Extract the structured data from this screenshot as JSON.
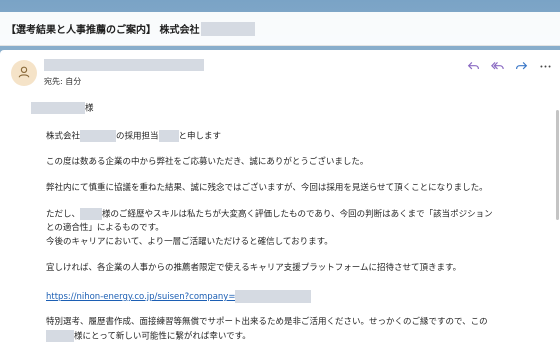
{
  "subject": {
    "title": "【選考結果と人事推薦のご案内】 株式会社"
  },
  "header": {
    "to_label": "宛先: 自分",
    "actions": [
      {
        "name": "reply-icon"
      },
      {
        "name": "reply-all-icon"
      },
      {
        "name": "forward-icon"
      },
      {
        "name": "more-icon"
      }
    ]
  },
  "message": {
    "salutation_suffix": "様",
    "line_intro_a": "株式会社",
    "line_intro_b": "の採用担当",
    "line_intro_c": "と申します",
    "line_thanks": "この度は数ある企業の中から弊社をご応募いただき、誠にありがとうございました。",
    "line_result": "弊社内にて慎重に協議を重ねた結果、誠に残念ではございますが、今回は採用を見送らせて頂くことになりました。",
    "line_however_a": "ただし、",
    "line_however_b": "様のご経歴やスキルは私たちが大変高く評価したものであり、今回の判断はあくまで「該当ポジション",
    "line_however_c": "との適合性」によるものです。",
    "line_future": "今後のキャリアにおいて、より一層ご活躍いただけると確信しております。",
    "line_invite": "宜しければ、各企業の人事からの推薦者限定で使えるキャリア支援プラットフォームに招待させて頂きます。",
    "link_text": "https://nihon-energy.co.jp/suisen?company=",
    "line_support_a": "特別選考、履歴書作成、面接練習等無償でサポート出来るため是非ご活用ください。せっかくのご縁ですので、この",
    "line_support_b": "様にとって新しい可能性に繋がれば幸いです。"
  }
}
